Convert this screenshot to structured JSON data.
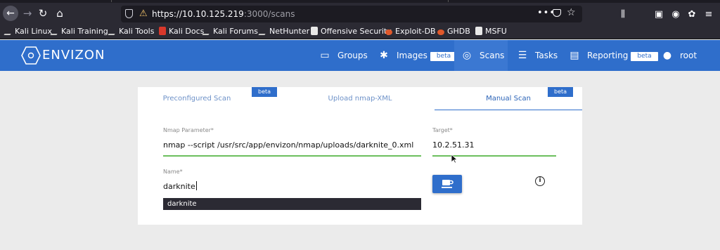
{
  "browser": {
    "url_host": "https://10.10.125.219",
    "url_path": ":3000/scans",
    "bookmarks": [
      {
        "label": "Kali Linux",
        "icon": "kali-icon"
      },
      {
        "label": "Kali Training",
        "icon": "kali-icon"
      },
      {
        "label": "Kali Tools",
        "icon": "kali-icon"
      },
      {
        "label": "Kali Docs",
        "icon": "kali-docs-icon"
      },
      {
        "label": "Kali Forums",
        "icon": "kali-icon"
      },
      {
        "label": "NetHunter",
        "icon": "nethunter-icon"
      },
      {
        "label": "Offensive Security",
        "icon": "offsec-icon"
      },
      {
        "label": "Exploit-DB",
        "icon": "exploit-db-icon"
      },
      {
        "label": "GHDB",
        "icon": "ghdb-icon"
      },
      {
        "label": "MSFU",
        "icon": "msfu-icon"
      }
    ]
  },
  "app": {
    "logo": "ENVIZON",
    "nav": [
      {
        "label": "Groups",
        "icon": "groups-icon"
      },
      {
        "label": "Images",
        "icon": "aperture-icon",
        "badge": "beta"
      },
      {
        "label": "Scans",
        "icon": "target-icon",
        "active": true
      },
      {
        "label": "Tasks",
        "icon": "tasks-icon"
      },
      {
        "label": "Reporting",
        "icon": "reporting-icon",
        "badge": "beta"
      },
      {
        "label": "root",
        "icon": "user-icon"
      }
    ],
    "accent": "#2f6ecb"
  },
  "scan": {
    "tabs": [
      {
        "label": "Preconfigured Scan",
        "badge": "beta"
      },
      {
        "label": "Upload nmap-XML"
      },
      {
        "label": "Manual Scan",
        "badge": "beta",
        "active": true
      }
    ],
    "param_label": "Nmap Parameter*",
    "param_value": "nmap --script /usr/src/app/envizon/nmap/uploads/darknite_0.xml",
    "target_label": "Target*",
    "target_value": "10.2.51.31",
    "name_label": "Name*",
    "name_value": "darknite",
    "suggestion": "darknite",
    "submit_icon": "coffee-cup-icon",
    "info_icon": "info-icon"
  }
}
